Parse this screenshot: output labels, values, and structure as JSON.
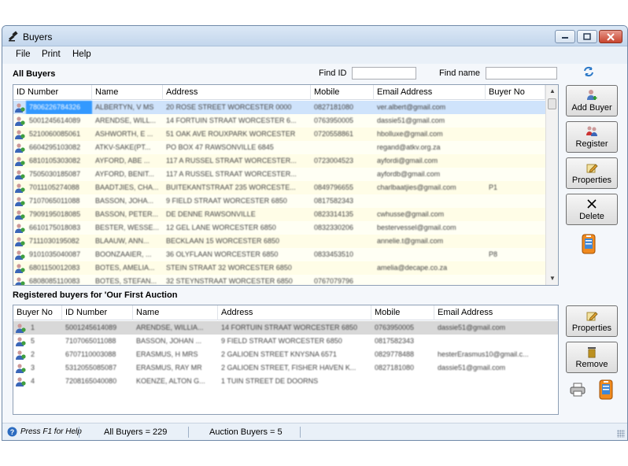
{
  "window": {
    "title": "Buyers",
    "icon": "gavel-icon"
  },
  "menu": [
    "File",
    "Print",
    "Help"
  ],
  "all_buyers": {
    "title": "All Buyers",
    "find_id_label": "Find ID",
    "find_id_value": "",
    "find_name_label": "Find name",
    "find_name_value": "",
    "columns": [
      "ID Number",
      "Name",
      "Address",
      "Mobile",
      "Email Address",
      "Buyer No"
    ],
    "rows": [
      [
        "7806226784326",
        "ALBERTYN, V MS",
        "20 ROSE STREET WORCESTER 0000",
        "0827181080",
        "ver.albert@gmail.com",
        ""
      ],
      [
        "5001245614089",
        "ARENDSE, WILL...",
        "14 FORTUIN STRAAT WORCESTER 6...",
        "0763950005",
        "dassie51@gmail.com",
        ""
      ],
      [
        "5210060085061",
        "ASHWORTH, E ...",
        "51 OAK AVE ROUXPARK WORCESTER",
        "0720558861",
        "hbolluxe@gmail.com",
        ""
      ],
      [
        "6604295103082",
        "ATKV-SAKE(PT...",
        "PO BOX 47 RAWSONVILLE 6845",
        "",
        "regand@atkv.org.za",
        ""
      ],
      [
        "6810105303082",
        "AYFORD, ABE ...",
        "117 A RUSSEL STRAAT WORCESTER...",
        "0723004523",
        "ayfordi@gmail.com",
        ""
      ],
      [
        "7505030185087",
        "AYFORD, BENIT...",
        "117 A RUSSEL STRAAT WORCESTER...",
        "",
        "ayfordb@gmail.com",
        ""
      ],
      [
        "7011105274088",
        "BAADTJIES, CHA...",
        "BUITEKANTSTRAAT 235 WORCESTE...",
        "0849796655",
        "charlbaatjies@gmail.com",
        "P1"
      ],
      [
        "7107065011088",
        "BASSON, JOHA...",
        "9 FIELD STRAAT WORCESTER 6850",
        "0817582343",
        "",
        ""
      ],
      [
        "7909195018085",
        "BASSON, PETER...",
        "DE DENNE RAWSONVILLE",
        "0823314135",
        "cwhusse@gmail.com",
        ""
      ],
      [
        "6610175018083",
        "BESTER, WESSE...",
        "12 GEL LANE WORCESTER 6850",
        "0832330206",
        "bestervessel@gmail.com",
        ""
      ],
      [
        "7111030195082",
        "BLAAUW, ANN...",
        "BECKLAAN 15 WORCESTER 6850",
        "",
        "annelie.t@gmail.com",
        ""
      ],
      [
        "9101035040087",
        "BOONZAAIER, ...",
        "36 OLYFLAAN WORCESTER 6850",
        "0833453510",
        "",
        "P8"
      ],
      [
        "6801150012083",
        "BOTES, AMELIA...",
        "STEIN STRAAT 32 WORCESTER 6850",
        "",
        "amelia@decape.co.za",
        ""
      ],
      [
        "6808085110083",
        "BOTES, STEFAN...",
        "32 STEYNSTRAAT WORCESTER 6850",
        "0767079796",
        "",
        ""
      ]
    ]
  },
  "registered": {
    "title": "Registered buyers for 'Our First Auction",
    "columns": [
      "Buyer No",
      "ID Number",
      "Name",
      "Address",
      "Mobile",
      "Email Address"
    ],
    "rows": [
      [
        "1",
        "5001245614089",
        "ARENDSE, WILLIA...",
        "14 FORTUIN STRAAT WORCESTER 6850",
        "0763950005",
        "dassie51@gmail.com"
      ],
      [
        "5",
        "7107065011088",
        "BASSON, JOHAN ...",
        "9 FIELD STRAAT WORCESTER 6850",
        "0817582343",
        ""
      ],
      [
        "2",
        "6707110003088",
        "ERASMUS, H MRS",
        "2 GALIOEN STREET KNYSNA 6571",
        "0829778488",
        "hesterErasmus10@gmail.c..."
      ],
      [
        "3",
        "5312055085087",
        "ERASMUS, RAY MR",
        "2 GALIOEN STREET, FISHER HAVEN K...",
        "0827181080",
        "dassie51@gmail.com"
      ],
      [
        "4",
        "7208165040080",
        "KOENZE, ALTON G...",
        "1 TUIN STREET DE DOORNS",
        "",
        ""
      ]
    ]
  },
  "buttons": {
    "add_buyer": "Add Buyer",
    "register": "Register",
    "properties": "Properties",
    "delete": "Delete",
    "properties2": "Properties",
    "remove": "Remove"
  },
  "status": {
    "help": "Press F1 for Help",
    "all_buyers": "All Buyers = 229",
    "auction_buyers": "Auction Buyers = 5"
  },
  "colors": {
    "selection": "#3399ff",
    "row_alt": "#fffde7"
  }
}
